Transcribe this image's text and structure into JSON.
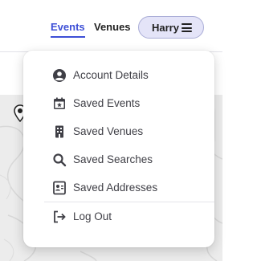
{
  "nav": {
    "events_label": "Events",
    "venues_label": "Venues",
    "user_name": "Harry"
  },
  "colors": {
    "accent": "#3d4fd6",
    "pill_bg": "#e4e4f8",
    "text": "#3f3f46"
  },
  "menu": {
    "items": [
      {
        "label": "Account Details",
        "icon": "account-circle-icon"
      },
      {
        "label": "Saved Events",
        "icon": "calendar-star-icon"
      },
      {
        "label": "Saved Venues",
        "icon": "building-icon"
      },
      {
        "label": "Saved Searches",
        "icon": "search-icon"
      },
      {
        "label": "Saved Addresses",
        "icon": "address-card-icon"
      },
      {
        "label": "Log Out",
        "icon": "logout-arrow-icon"
      }
    ]
  }
}
